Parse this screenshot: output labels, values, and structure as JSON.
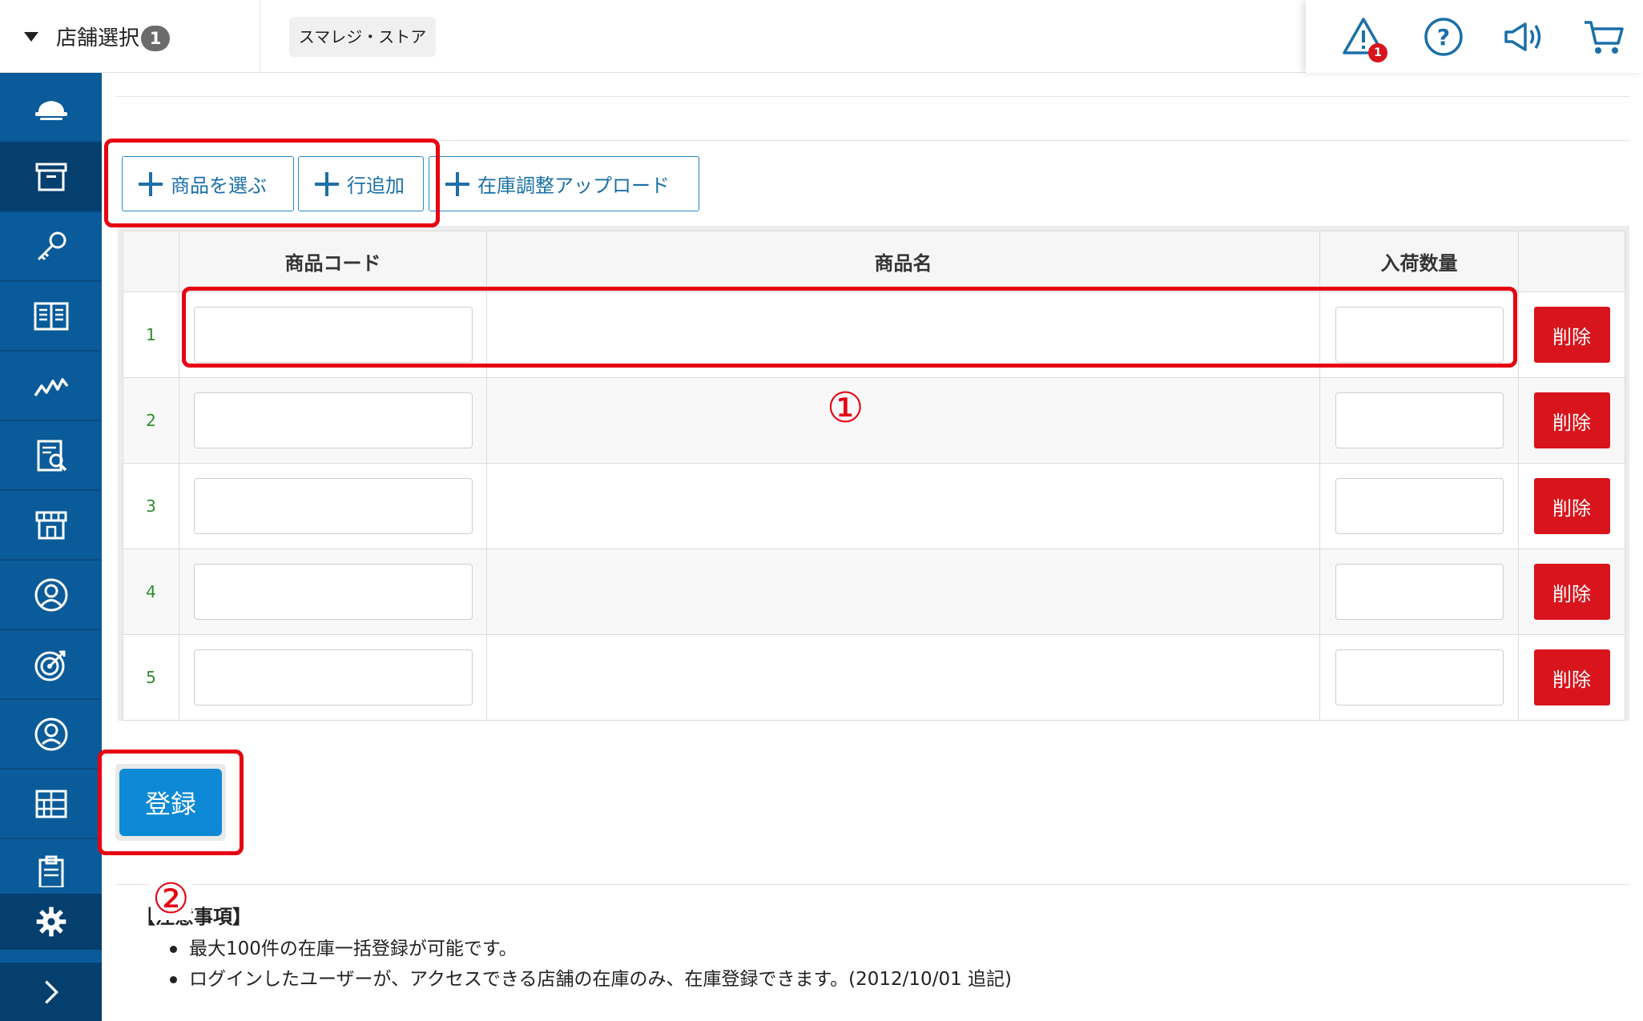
{
  "header": {
    "store_select_label": "店舗選択",
    "store_select_count": "1",
    "current_store": "スマレジ・ストア",
    "icons": [
      {
        "name": "warning-icon",
        "badge": "1"
      },
      {
        "name": "help-icon"
      },
      {
        "name": "megaphone-icon"
      },
      {
        "name": "cart-icon"
      }
    ]
  },
  "sidebar": {
    "items": [
      "cloud-icon",
      "box-icon",
      "key-icon",
      "book-icon",
      "chart-icon",
      "report-icon",
      "store-icon",
      "customer-icon",
      "target-icon",
      "user-icon",
      "grid-icon",
      "clipboard-icon"
    ],
    "active_index": 1,
    "bottom": [
      "gear-icon",
      "chevron-right-icon"
    ]
  },
  "toolbar": {
    "select_products": "商品を選ぶ",
    "add_row": "行追加",
    "stock_upload": "在庫調整アップロード"
  },
  "table": {
    "headers": {
      "code": "商品コード",
      "name": "商品名",
      "quantity": "入荷数量"
    },
    "rows": [
      {
        "num": "1",
        "code": "",
        "name": "",
        "qty": ""
      },
      {
        "num": "2",
        "code": "",
        "name": "",
        "qty": ""
      },
      {
        "num": "3",
        "code": "",
        "name": "",
        "qty": ""
      },
      {
        "num": "4",
        "code": "",
        "name": "",
        "qty": ""
      },
      {
        "num": "5",
        "code": "",
        "name": "",
        "qty": ""
      }
    ],
    "delete_label": "削除"
  },
  "register_label": "登録",
  "notes": {
    "title": "【注意事項】",
    "items": [
      "最大100件の在庫一括登録が可能です。",
      "ログインしたユーザーが、アクセスできる店舗の在庫のみ、在庫登録できます。(2012/10/01 追記)"
    ]
  },
  "annotations": {
    "marker_1": "①",
    "marker_2": "②"
  },
  "colors": {
    "sidebar": "#0a5b99",
    "sidebar_active": "#053f6e",
    "primary": "#0e89d6",
    "danger": "#d8141c",
    "annotation": "#e60012"
  }
}
